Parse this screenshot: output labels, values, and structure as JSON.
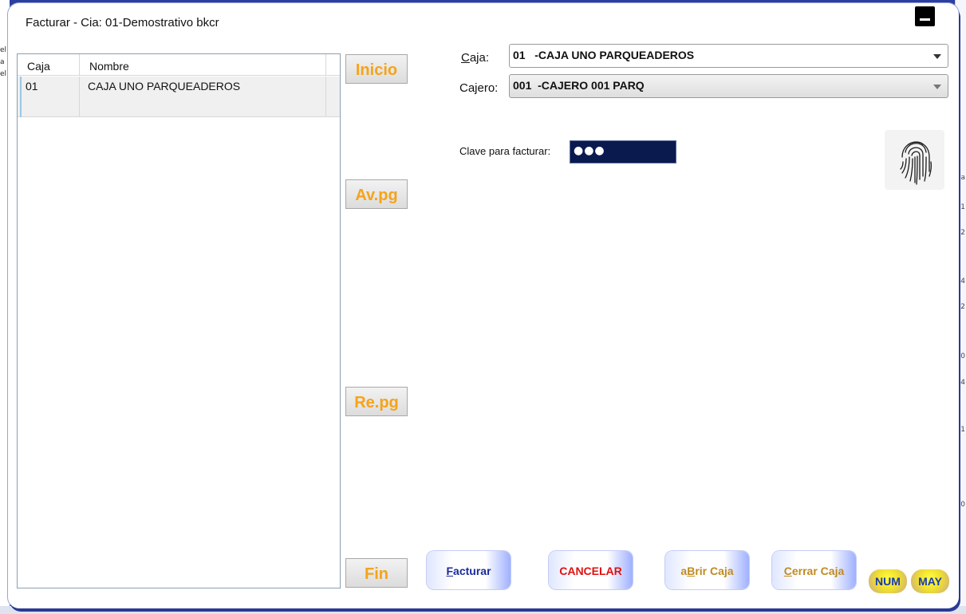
{
  "window": {
    "title": "Facturar - Cia: 01-Demostrativo bkcr"
  },
  "grid": {
    "columns": [
      "Caja",
      "Nombre"
    ],
    "rows": [
      {
        "caja": "01",
        "nombre": "CAJA UNO PARQUEADEROS"
      }
    ]
  },
  "nav": {
    "inicio": "Inicio",
    "avpg": "Av.pg",
    "repg": "Re.pg",
    "fin": "Fin"
  },
  "form": {
    "caja_label_key": "C",
    "caja_label_rest": "aja:",
    "caja_value": "01   -CAJA UNO PARQUEADEROS",
    "cajero_label": "Cajero:",
    "cajero_value": "001  -CAJERO 001 PARQ",
    "password_label": "Clave para facturar:",
    "password_value": "●●●"
  },
  "actions": {
    "facturar_key": "F",
    "facturar_rest": "acturar",
    "cancelar": "CANCELAR",
    "abrir_pre": "a",
    "abrir_key": "B",
    "abrir_rest": "rir Caja",
    "cerrar_key": "C",
    "cerrar_rest": "errar Caja"
  },
  "status": {
    "num": "NUM",
    "may": "MAY"
  },
  "colors": {
    "nav_text": "#f5a31a",
    "facturar_text": "#1a2a9a",
    "cancelar_text": "#e01010",
    "caja_text": "#c08a20",
    "pill_text": "#1a3ab0",
    "password_bg": "#0a1a4f"
  },
  "background": {
    "left_fragments": [
      "el",
      "a",
      "el"
    ],
    "right_fragments": [
      "a",
      "1",
      "2",
      "4",
      "2",
      "0",
      "4",
      "1",
      "0"
    ]
  }
}
